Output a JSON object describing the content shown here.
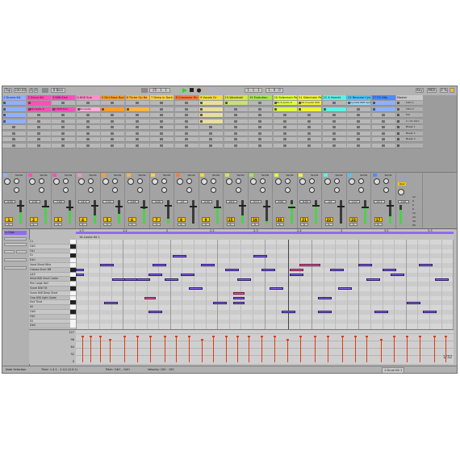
{
  "transport": {
    "tap": "Tap",
    "tempo": "100.00",
    "sig_num": "4",
    "sig_den": "4",
    "quant": "8 Bars",
    "position": "25 . 1 . 1",
    "loop_start": "1 . 1 . 1",
    "loop_len": "1 . 0 . 0",
    "key_label": "Key",
    "midi_label": "MIDI",
    "cpu": "4 %"
  },
  "tracks": [
    {
      "name": "1 Drums Kit",
      "color": "#8fb0ff",
      "num": "1",
      "vol": "-0.00",
      "slots": [
        {
          "c": "#8fb0ff",
          "t": ""
        },
        {
          "c": "#8fb0ff",
          "t": ""
        },
        {
          "c": "#8fb0ff",
          "t": ""
        },
        {
          "c": "#8fb0ff",
          "t": ""
        },
        {
          "c": "",
          "t": ""
        },
        {
          "c": "",
          "t": ""
        },
        {
          "c": "",
          "t": ""
        },
        {
          "c": "",
          "t": ""
        }
      ]
    },
    {
      "name": "2 Drum Kit",
      "color": "#ff4fb7",
      "num": "2",
      "vol": "-2.34",
      "slots": [
        {
          "c": "#ff4fb7",
          "t": ""
        },
        {
          "c": "#ff4fb7",
          "t": "16-Castle K"
        },
        {
          "c": "",
          "t": ""
        },
        {
          "c": "",
          "t": ""
        },
        {
          "c": "",
          "t": ""
        },
        {
          "c": "",
          "t": ""
        },
        {
          "c": "",
          "t": ""
        },
        {
          "c": "",
          "t": ""
        }
      ]
    },
    {
      "name": "3 808 Kick",
      "color": "#ff4fb7",
      "num": "3",
      "vol": "-7.00",
      "slots": [
        {
          "c": "",
          "t": ""
        },
        {
          "c": "#ff4fb7",
          "t": "3-808 Kick"
        },
        {
          "c": "",
          "t": ""
        },
        {
          "c": "",
          "t": ""
        },
        {
          "c": "",
          "t": ""
        },
        {
          "c": "",
          "t": ""
        },
        {
          "c": "",
          "t": ""
        },
        {
          "c": "",
          "t": ""
        }
      ]
    },
    {
      "name": "4 808 Sub",
      "color": "#ff8ec9",
      "num": "4",
      "vol": "-14.3",
      "slots": [
        {
          "c": "",
          "t": ""
        },
        {
          "c": "#ffb0d8",
          "t": "16-Castle"
        },
        {
          "c": "",
          "t": ""
        },
        {
          "c": "",
          "t": ""
        },
        {
          "c": "",
          "t": ""
        },
        {
          "c": "",
          "t": ""
        },
        {
          "c": "",
          "t": ""
        },
        {
          "c": "",
          "t": ""
        }
      ]
    },
    {
      "name": "5 Dirt Bass Rock",
      "color": "#ff9e2a",
      "num": "5",
      "vol": "-7.11",
      "slots": [
        {
          "c": "",
          "t": ""
        },
        {
          "c": "#ff9e2a",
          "t": ""
        },
        {
          "c": "",
          "t": ""
        },
        {
          "c": "",
          "t": ""
        },
        {
          "c": "",
          "t": ""
        },
        {
          "c": "",
          "t": ""
        },
        {
          "c": "",
          "t": ""
        },
        {
          "c": "",
          "t": ""
        }
      ]
    },
    {
      "name": "6 Three Op Ba",
      "color": "#ffb347",
      "num": "6",
      "vol": "-4.95",
      "slots": [
        {
          "c": "",
          "t": ""
        },
        {
          "c": "#ffb347",
          "t": ""
        },
        {
          "c": "",
          "t": ""
        },
        {
          "c": "",
          "t": ""
        },
        {
          "c": "",
          "t": ""
        },
        {
          "c": "",
          "t": ""
        },
        {
          "c": "",
          "t": ""
        },
        {
          "c": "",
          "t": ""
        }
      ]
    },
    {
      "name": "7 Deep in Dark",
      "color": "#ffcf4a",
      "num": "7",
      "vol": "-9.00",
      "slots": [
        {
          "c": "",
          "t": ""
        },
        {
          "c": "",
          "t": ""
        },
        {
          "c": "",
          "t": ""
        },
        {
          "c": "",
          "t": ""
        },
        {
          "c": "",
          "t": ""
        },
        {
          "c": "",
          "t": ""
        },
        {
          "c": "",
          "t": ""
        },
        {
          "c": "",
          "t": ""
        }
      ]
    },
    {
      "name": "8 Crossover Ru",
      "color": "#ff7a3a",
      "num": "8",
      "vol": "-inf",
      "slots": [
        {
          "c": "",
          "t": ""
        },
        {
          "c": "",
          "t": ""
        },
        {
          "c": "",
          "t": ""
        },
        {
          "c": "",
          "t": ""
        },
        {
          "c": "",
          "t": ""
        },
        {
          "c": "",
          "t": ""
        },
        {
          "c": "",
          "t": ""
        },
        {
          "c": "",
          "t": ""
        }
      ]
    },
    {
      "name": "9 Vocals Gr",
      "color": "#f5d73a",
      "num": "9",
      "vol": "-0.00",
      "slots": [
        {
          "c": "#e8df9a",
          "t": ""
        },
        {
          "c": "#e8df9a",
          "t": ""
        },
        {
          "c": "#e8df9a",
          "t": ""
        },
        {
          "c": "#e8df9a",
          "t": ""
        },
        {
          "c": "",
          "t": ""
        },
        {
          "c": "",
          "t": ""
        },
        {
          "c": "",
          "t": ""
        },
        {
          "c": "",
          "t": ""
        }
      ]
    },
    {
      "name": "15 Wavetabl",
      "color": "#d8e34a",
      "num": "15",
      "vol": "-24.6",
      "slots": [
        {
          "c": "#c7e07a",
          "t": ""
        },
        {
          "c": "",
          "t": ""
        },
        {
          "c": "",
          "t": ""
        },
        {
          "c": "",
          "t": ""
        },
        {
          "c": "",
          "t": ""
        },
        {
          "c": "",
          "t": ""
        },
        {
          "c": "",
          "t": ""
        },
        {
          "c": "",
          "t": ""
        }
      ]
    },
    {
      "name": "19 Evolution",
      "color": "#a9e64e",
      "num": "19",
      "vol": "-57.3",
      "slots": [
        {
          "c": "",
          "t": ""
        },
        {
          "c": "",
          "t": ""
        },
        {
          "c": "",
          "t": ""
        },
        {
          "c": "",
          "t": ""
        },
        {
          "c": "",
          "t": ""
        },
        {
          "c": "",
          "t": ""
        },
        {
          "c": "",
          "t": ""
        },
        {
          "c": "",
          "t": ""
        }
      ]
    },
    {
      "name": "20 Sidechain Pad",
      "color": "#dfff3a",
      "num": "20",
      "vol": "-5.81",
      "slots": [
        {
          "c": "#dfff3a",
          "t": "16-3-Audio 0"
        },
        {
          "c": "#dfff3a",
          "t": ""
        },
        {
          "c": "",
          "t": ""
        },
        {
          "c": "",
          "t": ""
        },
        {
          "c": "",
          "t": ""
        },
        {
          "c": "",
          "t": ""
        },
        {
          "c": "",
          "t": ""
        },
        {
          "c": "",
          "t": ""
        }
      ]
    },
    {
      "name": "21 Sidechain Pad",
      "color": "#f2f23a",
      "num": "21",
      "vol": "-8.00",
      "slots": [
        {
          "c": "#f2f23a",
          "t": "16-3-Audio 000"
        },
        {
          "c": "#f2f23a",
          "t": ""
        },
        {
          "c": "",
          "t": ""
        },
        {
          "c": "",
          "t": ""
        },
        {
          "c": "",
          "t": ""
        },
        {
          "c": "",
          "t": ""
        },
        {
          "c": "",
          "t": ""
        },
        {
          "c": "",
          "t": ""
        }
      ]
    },
    {
      "name": "22 A Hornet",
      "color": "#5ff0e8",
      "num": "22",
      "vol": "-inf",
      "slots": [
        {
          "c": "",
          "t": ""
        },
        {
          "c": "#5ff0e8",
          "t": ""
        },
        {
          "c": "",
          "t": ""
        },
        {
          "c": "",
          "t": ""
        },
        {
          "c": "",
          "t": ""
        },
        {
          "c": "",
          "t": ""
        },
        {
          "c": "",
          "t": ""
        },
        {
          "c": "",
          "t": ""
        }
      ]
    },
    {
      "name": "23 Reverse Cymbal",
      "color": "#4ac6ff",
      "num": "23",
      "vol": "-1.17",
      "slots": [
        {
          "c": "#9ed8ff",
          "t": "Cymbal 808 Verb"
        },
        {
          "c": "",
          "t": ""
        },
        {
          "c": "",
          "t": ""
        },
        {
          "c": "",
          "t": ""
        },
        {
          "c": "",
          "t": ""
        },
        {
          "c": "",
          "t": ""
        },
        {
          "c": "",
          "t": ""
        },
        {
          "c": "",
          "t": ""
        }
      ]
    },
    {
      "name": "17 FX Hits",
      "color": "#4a8cff",
      "num": "17",
      "vol": "-11.7",
      "slots": [
        {
          "c": "#8fb0ff",
          "t": ""
        },
        {
          "c": "#8fb0ff",
          "t": ""
        },
        {
          "c": "",
          "t": ""
        },
        {
          "c": "",
          "t": ""
        },
        {
          "c": "",
          "t": ""
        },
        {
          "c": "",
          "t": ""
        },
        {
          "c": "",
          "t": ""
        },
        {
          "c": "",
          "t": ""
        }
      ]
    }
  ],
  "master": {
    "name": "Master",
    "scenes": [
      "Intro 1",
      "Intro 2",
      "Full",
      "2 / 21 Intro",
      "Break 1",
      "Break 2",
      "Break 3",
      ""
    ],
    "vol": "0.00",
    "post": "Post"
  },
  "mixer": {
    "sends_label": "Sends",
    "send_a": "A",
    "send_b": "B",
    "solo": "S",
    "rec": "C",
    "scale": [
      "12",
      "6",
      "0",
      "6",
      "12",
      "24",
      "36",
      "60"
    ]
  },
  "clip": {
    "name": "1-Clips",
    "clip_title": "16-Castle Kit 1",
    "ruler_marks": [
      "1.3",
      "1.4",
      "2",
      "2.2",
      "2.3",
      "2.4",
      "3",
      "3.2",
      "3.3"
    ],
    "key_names": [
      "C1",
      "G#1",
      "F#1",
      "E1",
      "D#1",
      "Vocal Shout Wha",
      "Cabasa Short 8M",
      "A#0",
      "Hihat 808 Short Castle",
      "Rim Large Hall",
      "Snare 808 Tilt",
      "Snare 808 Deep Short",
      "Clap 808 Light Gaate",
      "Kick Thud",
      "A0",
      "G#0",
      "F#0",
      "E0",
      "D#0"
    ],
    "vel_scale": [
      "127",
      "96",
      "64",
      "32",
      "0"
    ],
    "page": "1/32",
    "notes_label": "Notes"
  },
  "status": {
    "mode": "Note Selection",
    "time": "Time: 1.4.1 - 1.4.2 (0.0.1)",
    "pitch": "Pitch: G#1 - G#1",
    "velocity": "Velocity: 100 - 100",
    "right": "1 Drum Kit 1"
  },
  "colors": {
    "accent": "#f2c700",
    "play": "#2fd12f",
    "note": "#8f6bef",
    "selected_note": "#ef5da9"
  }
}
